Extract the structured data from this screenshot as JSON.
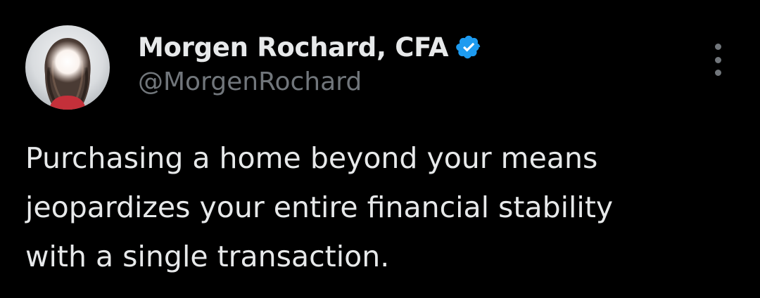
{
  "author": {
    "display_name": "Morgen Rochard, CFA",
    "handle": "@MorgenRochard",
    "verified": true,
    "verified_color": "#1d9bf0"
  },
  "tweet": {
    "lines": [
      "Purchasing a home beyond your means",
      "jeopardizes your entire financial stability",
      "with a single transaction."
    ]
  },
  "icons": {
    "verified": "verified-badge-icon",
    "more": "more-options-icon"
  },
  "colors": {
    "background": "#000000",
    "text_primary": "#e7e9ea",
    "text_secondary": "#71767b"
  }
}
